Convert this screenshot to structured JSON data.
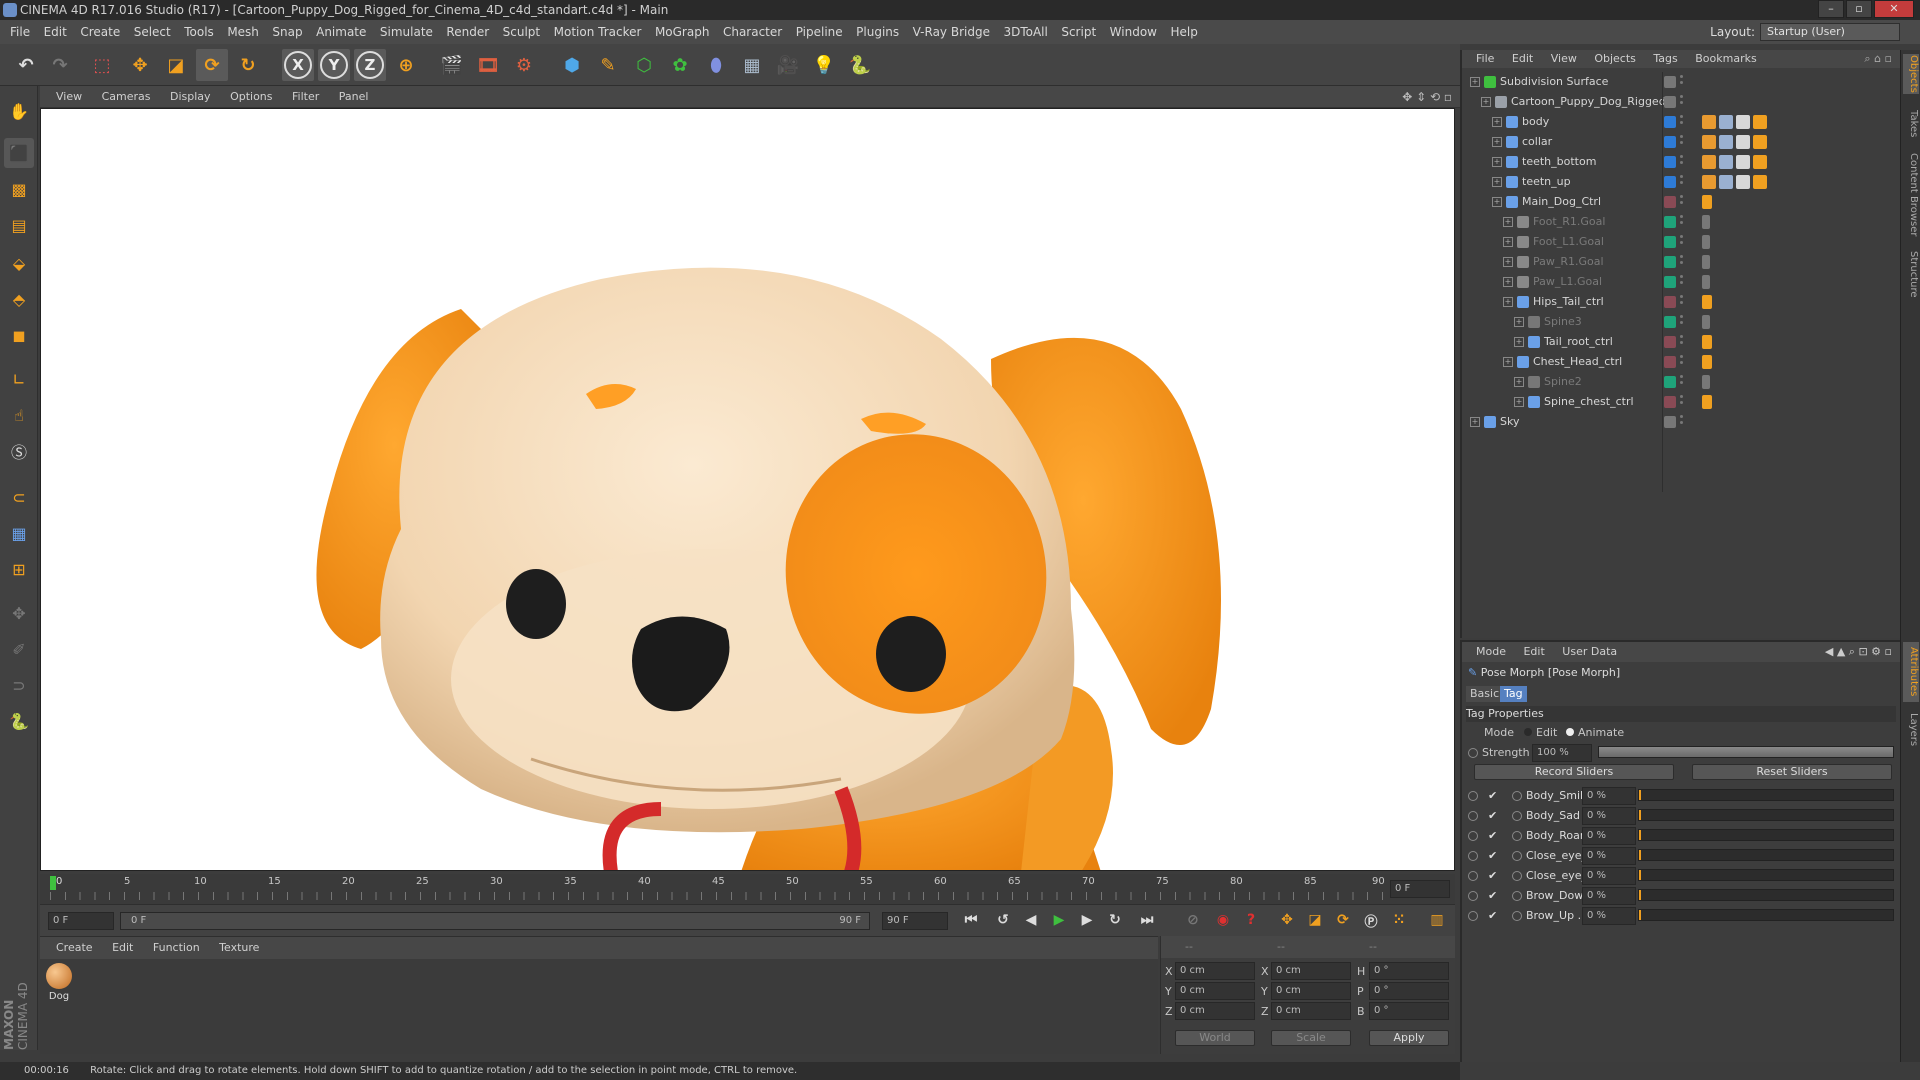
{
  "window": {
    "title": "CINEMA 4D R17.016 Studio (R17) - [Cartoon_Puppy_Dog_Rigged_for_Cinema_4D_c4d_standart.c4d *] - Main"
  },
  "menubar": {
    "items": [
      "File",
      "Edit",
      "Create",
      "Select",
      "Tools",
      "Mesh",
      "Snap",
      "Animate",
      "Simulate",
      "Render",
      "Sculpt",
      "Motion Tracker",
      "MoGraph",
      "Character",
      "Pipeline",
      "Plugins",
      "V-Ray Bridge",
      "3DToAll",
      "Script",
      "Window",
      "Help"
    ],
    "layout_label": "Layout:",
    "layout_value": "Startup (User)"
  },
  "viewport": {
    "menu": [
      "View",
      "Cameras",
      "Display",
      "Options",
      "Filter",
      "Panel"
    ]
  },
  "timeline": {
    "ticks": [
      "0",
      "5",
      "10",
      "15",
      "20",
      "25",
      "30",
      "35",
      "40",
      "45",
      "50",
      "55",
      "60",
      "65",
      "70",
      "75",
      "80",
      "85",
      "90"
    ],
    "current_frame": "0 F",
    "start_field": "0 F",
    "range_start": "0 F",
    "range_end": "90 F",
    "end_field": "90 F"
  },
  "material_manager": {
    "menu": [
      "Create",
      "Edit",
      "Function",
      "Texture"
    ],
    "materials": [
      {
        "name": "Dog"
      }
    ]
  },
  "coordinates": {
    "header": [
      "--",
      "--",
      "--"
    ],
    "rows": [
      {
        "a": "X",
        "pos": "0 cm",
        "b": "X",
        "size": "0 cm",
        "c": "H",
        "rot": "0 °"
      },
      {
        "a": "Y",
        "pos": "0 cm",
        "b": "Y",
        "size": "0 cm",
        "c": "P",
        "rot": "0 °"
      },
      {
        "a": "Z",
        "pos": "0 cm",
        "b": "Z",
        "size": "0 cm",
        "c": "B",
        "rot": "0 °"
      }
    ],
    "mode1": "World",
    "mode2": "Scale",
    "apply": "Apply"
  },
  "status": {
    "time": "00:00:16",
    "message": "Rotate: Click and drag to rotate elements. Hold down SHIFT to add to quantize rotation / add to the selection in point mode, CTRL to remove."
  },
  "object_manager": {
    "menu": [
      "File",
      "Edit",
      "View",
      "Objects",
      "Tags",
      "Bookmarks"
    ],
    "objects": [
      {
        "name": "Subdivision Surface",
        "depth": 0,
        "icon_color": "#3fbf3f",
        "vis": "#777777",
        "dim": false
      },
      {
        "name": "Cartoon_Puppy_Dog_Rigged",
        "depth": 1,
        "icon_color": "#9aa0a8",
        "vis": "#777777",
        "dim": false
      },
      {
        "name": "body",
        "depth": 2,
        "icon_color": "#6aa0e8",
        "vis": "#2e7bd6",
        "dim": false
      },
      {
        "name": "collar",
        "depth": 2,
        "icon_color": "#6aa0e8",
        "vis": "#2e7bd6",
        "dim": false
      },
      {
        "name": "teeth_bottom",
        "depth": 2,
        "icon_color": "#6aa0e8",
        "vis": "#2e7bd6",
        "dim": false
      },
      {
        "name": "teetn_up",
        "depth": 2,
        "icon_color": "#6aa0e8",
        "vis": "#2e7bd6",
        "dim": false
      },
      {
        "name": "Main_Dog_Ctrl",
        "depth": 2,
        "icon_color": "#6aa0e8",
        "vis": "#8a4a55",
        "dim": false
      },
      {
        "name": "Foot_R1.Goal",
        "depth": 3,
        "icon_color": "#888888",
        "vis": "#1fa37a",
        "dim": true
      },
      {
        "name": "Foot_L1.Goal",
        "depth": 3,
        "icon_color": "#888888",
        "vis": "#1fa37a",
        "dim": true
      },
      {
        "name": "Paw_R1.Goal",
        "depth": 3,
        "icon_color": "#888888",
        "vis": "#1fa37a",
        "dim": true
      },
      {
        "name": "Paw_L1.Goal",
        "depth": 3,
        "icon_color": "#888888",
        "vis": "#1fa37a",
        "dim": true
      },
      {
        "name": "Hips_Tail_ctrl",
        "depth": 3,
        "icon_color": "#6aa0e8",
        "vis": "#8a4a55",
        "dim": false
      },
      {
        "name": "Spine3",
        "depth": 4,
        "icon_color": "#777777",
        "vis": "#1fa37a",
        "dim": true
      },
      {
        "name": "Tail_root_ctrl",
        "depth": 4,
        "icon_color": "#6aa0e8",
        "vis": "#8a4a55",
        "dim": false
      },
      {
        "name": "Chest_Head_ctrl",
        "depth": 3,
        "icon_color": "#6aa0e8",
        "vis": "#8a4a55",
        "dim": false
      },
      {
        "name": "Spine2",
        "depth": 4,
        "icon_color": "#777777",
        "vis": "#1fa37a",
        "dim": true
      },
      {
        "name": "Spine_chest_ctrl",
        "depth": 4,
        "icon_color": "#6aa0e8",
        "vis": "#8a4a55",
        "dim": false
      },
      {
        "name": "Sky",
        "depth": 0,
        "icon_color": "#6aa0e8",
        "vis": "#777777",
        "dim": false
      }
    ]
  },
  "attributes": {
    "menu": [
      "Mode",
      "Edit",
      "User Data"
    ],
    "title": "Pose Morph [Pose Morph]",
    "tabs": [
      "Basic",
      "Tag"
    ],
    "section": "Tag Properties",
    "mode_label": "Mode",
    "mode_options": [
      "Edit",
      "Animate"
    ],
    "strength_label": "Strength",
    "strength_value": "100 %",
    "strength_fraction": 1.0,
    "record_btn": "Record Sliders",
    "reset_btn": "Reset Sliders",
    "sliders": [
      {
        "name": "Body_Smile",
        "value": "0 %"
      },
      {
        "name": "Body_Sad . .",
        "value": "0 %"
      },
      {
        "name": "Body_Roar",
        "value": "0 %"
      },
      {
        "name": "Close_eye_L",
        "value": "0 %"
      },
      {
        "name": "Close_eye_R",
        "value": "0 %"
      },
      {
        "name": "Brow_Down",
        "value": "0 %"
      },
      {
        "name": "Brow_Up . .",
        "value": "0 %"
      }
    ]
  },
  "side_tabs": [
    "Objects",
    "Takes",
    "Content Browser",
    "Structure"
  ],
  "side_tabs2": [
    "Attributes",
    "Layers"
  ],
  "brand": {
    "line1": "MAXON",
    "line2": "CINEMA 4D"
  }
}
